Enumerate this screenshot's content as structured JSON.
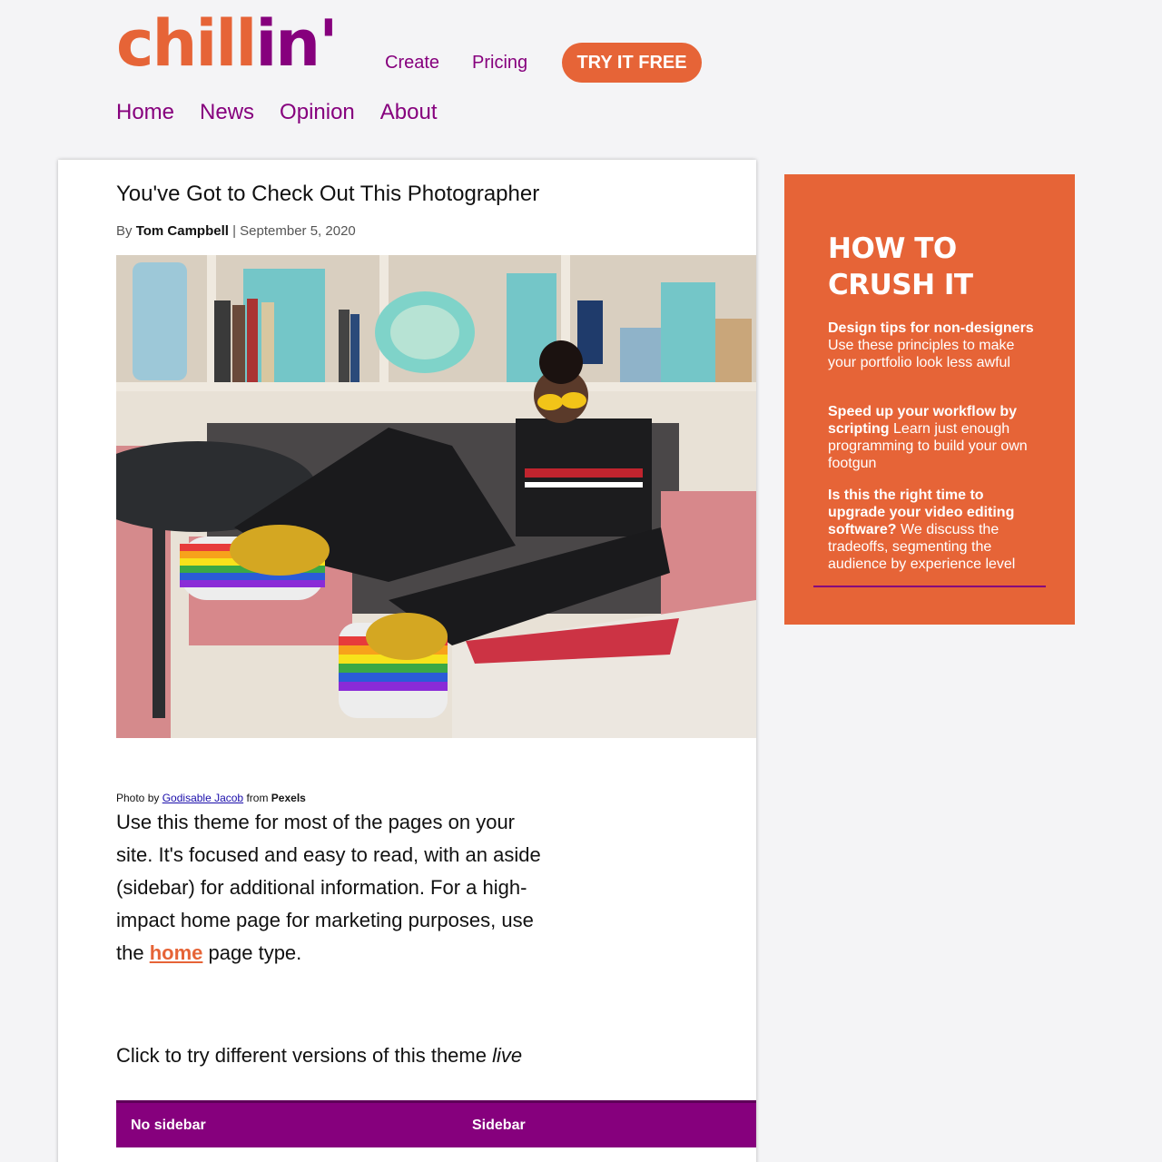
{
  "header": {
    "logo_part1": "chill",
    "logo_part2": "in'",
    "top_links": [
      "Create",
      "Pricing"
    ],
    "cta_label": "TRY IT FREE"
  },
  "nav": [
    "Home",
    "News",
    "Opinion",
    "About"
  ],
  "article": {
    "title": "You've Got to Check Out This Photographer",
    "by_prefix": "By",
    "author": "Tom Campbell",
    "separator": "|",
    "date": "September 5, 2020",
    "credit": {
      "prefix": "Photo by",
      "photographer": "Godisable Jacob",
      "middle": "from",
      "source": "Pexels"
    },
    "body_before_link": "Use this theme for most of the pages on your site. It's focused and easy to read, with an aside (sidebar) for additional information. For a high-impact home page for marketing purposes, use the",
    "body_link": "home",
    "body_after_link": "page type.",
    "try_text": "Click to try different versions of this theme",
    "try_text_em": "live",
    "table_headers": [
      "No sidebar",
      "Sidebar"
    ]
  },
  "aside": {
    "heading": "HOW TO CRUSH IT",
    "tips": [
      {
        "bold": "Design tips for non-designers",
        "text": "Use these principles to make your portfolio look less awful"
      },
      {
        "bold": "Speed up your workflow by scripting",
        "text": "Learn just enough programming to build your own footgun"
      },
      {
        "bold": "Is this the right time to upgrade your video editing software?",
        "text": "We discuss the tradeoffs, segmenting the audience by experience level"
      }
    ]
  },
  "colors": {
    "brand_orange": "#e66437",
    "brand_purple": "#86007d",
    "page_bg": "#f4f4f6"
  }
}
